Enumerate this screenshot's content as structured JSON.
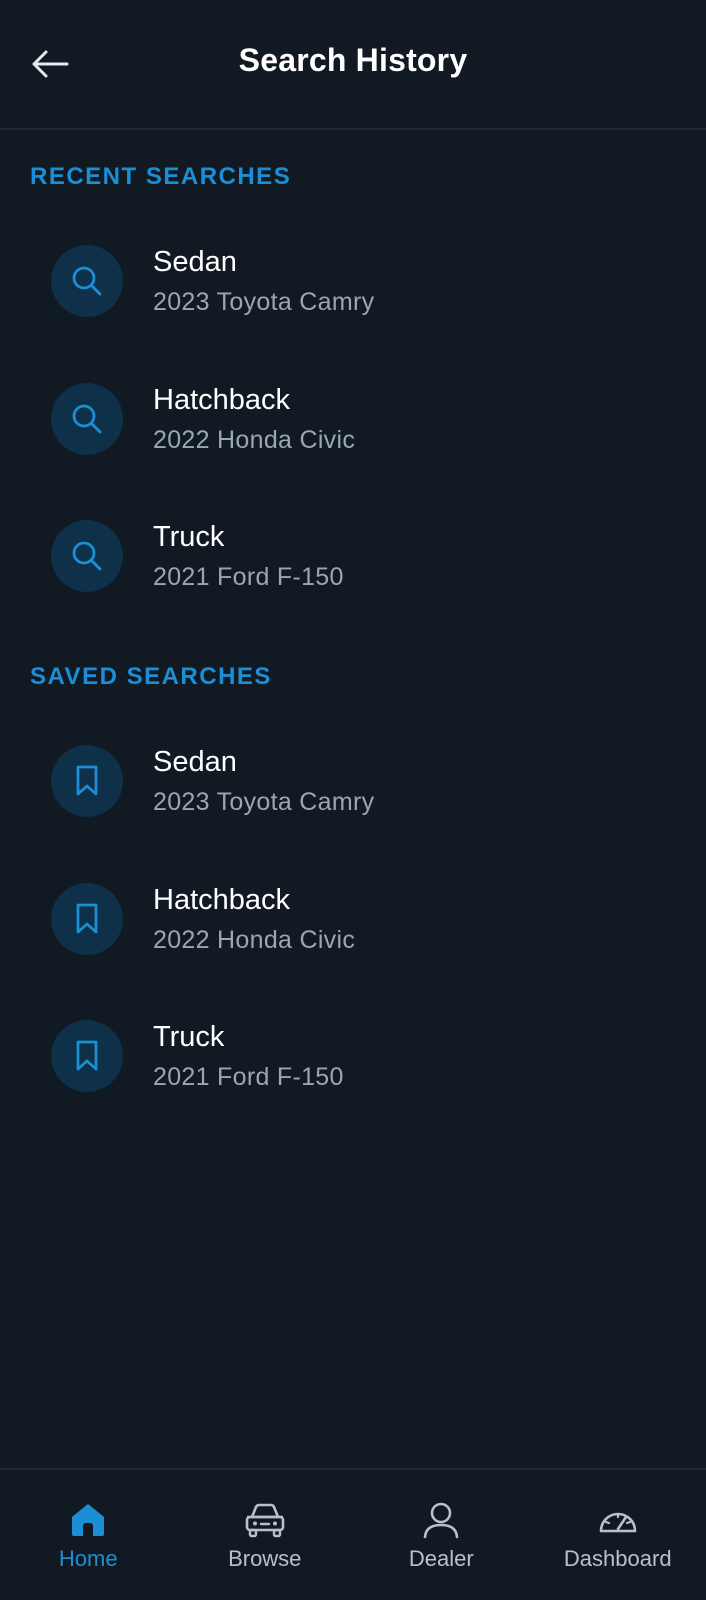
{
  "header": {
    "title": "Search History"
  },
  "recent": {
    "title": "RECENT SEARCHES",
    "items": [
      {
        "title": "Sedan",
        "subtitle": "2023 Toyota Camry"
      },
      {
        "title": "Hatchback",
        "subtitle": "2022 Honda Civic"
      },
      {
        "title": "Truck",
        "subtitle": "2021 Ford F-150"
      }
    ]
  },
  "saved": {
    "title": "SAVED SEARCHES",
    "items": [
      {
        "title": "Sedan",
        "subtitle": "2023 Toyota Camry"
      },
      {
        "title": "Hatchback",
        "subtitle": "2022 Honda Civic"
      },
      {
        "title": "Truck",
        "subtitle": "2021 Ford F-150"
      }
    ]
  },
  "nav": {
    "items": [
      {
        "label": "Home",
        "icon": "home-icon",
        "active": true
      },
      {
        "label": "Browse",
        "icon": "car-icon",
        "active": false
      },
      {
        "label": "Dealer",
        "icon": "person-icon",
        "active": false
      },
      {
        "label": "Dashboard",
        "icon": "speedometer-icon",
        "active": false
      }
    ]
  },
  "colors": {
    "background": "#111a22",
    "accent": "#1b8fd6",
    "icon_circle": "#0e3049",
    "subtitle": "#9aa6b2",
    "nav_inactive": "#b8c1ca"
  }
}
